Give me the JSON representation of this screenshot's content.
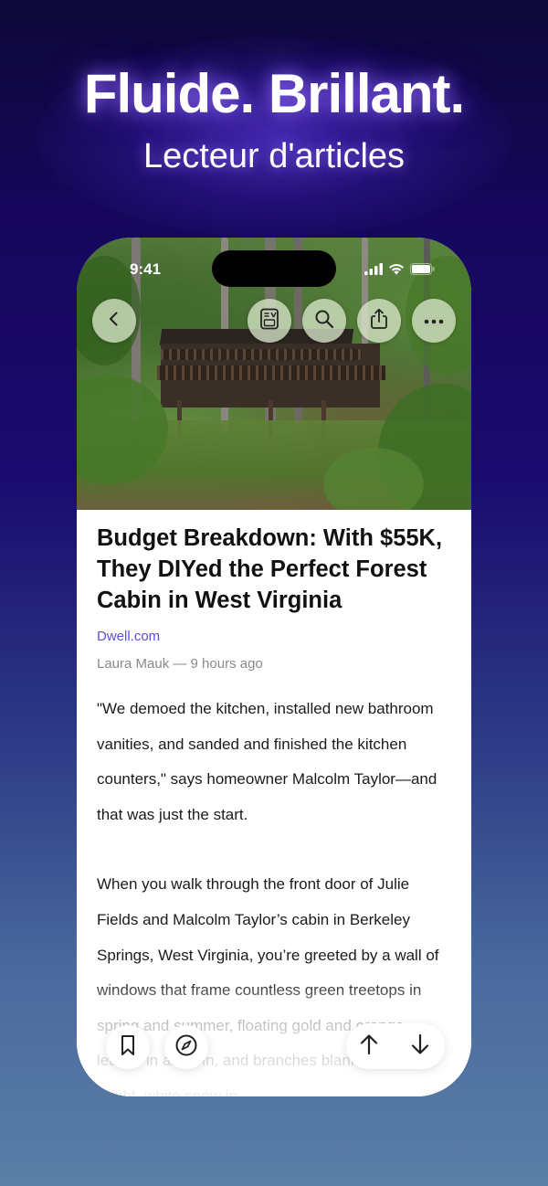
{
  "promo": {
    "headline": "Fluide. Brillant.",
    "subheadline": "Lecteur d'articles"
  },
  "status_bar": {
    "time": "9:41",
    "icons": [
      "signal-icon",
      "wifi-icon",
      "battery-icon"
    ]
  },
  "top_toolbar": {
    "buttons": [
      "back-icon",
      "reader-mode-icon",
      "search-icon",
      "share-icon",
      "more-icon"
    ]
  },
  "article": {
    "title": "Budget Breakdown: With $55K, They DIYed the Perfect Forest Cabin in West Virginia",
    "source": "Dwell.com",
    "byline": "Laura Mauk — 9 hours ago",
    "paragraphs": [
      "\"We demoed the kitchen, installed new bathroom vanities, and sanded and finished the kitchen counters,\" says homeowner Malcolm Taylor—and that was just the start.",
      "When you walk through the front door of Julie Fields and Malcolm Taylor’s cabin in Berkeley Springs, West Virginia, you’re greeted by a wall of windows that frame countless green treetops in spring and summer, floating gold and orange leaves in autumn, and branches blanketed with bright, white snow in"
    ]
  },
  "bottom_toolbar": {
    "buttons": [
      "bookmark-icon",
      "compass-icon",
      "arrow-up-icon",
      "arrow-down-icon"
    ]
  },
  "colors": {
    "link": "#5b4fd6",
    "background_top": "#16075c",
    "background_bottom": "#5a7ea6"
  }
}
